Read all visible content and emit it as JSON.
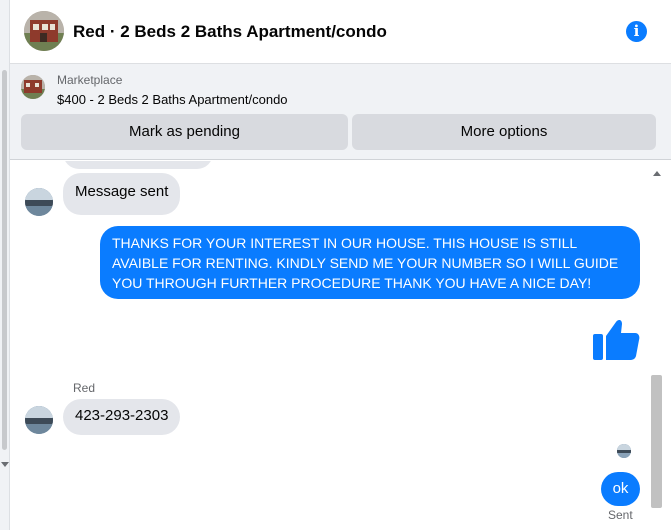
{
  "header": {
    "title": "Red · 2 Beds 2 Baths Apartment/condo",
    "info_icon": "info-icon"
  },
  "marketplace": {
    "label": "Marketplace",
    "listing": "$400 - 2 Beds 2 Baths Apartment/condo",
    "buttons": {
      "pending": "Mark as pending",
      "more": "More options"
    }
  },
  "messages": [
    {
      "from": "other",
      "text": "Message sent"
    },
    {
      "from": "me",
      "text": "THANKS FOR YOUR INTEREST IN OUR HOUSE. THIS HOUSE IS STILL AVAIBLE FOR RENTING. KINDLY SEND ME YOUR NUMBER SO I WILL GUIDE YOU THROUGH FURTHER PROCEDURE THANK YOU HAVE A NICE DAY!"
    },
    {
      "from": "me",
      "type": "like",
      "icon": "thumbs-up-icon"
    },
    {
      "from": "other",
      "sender": "Red",
      "text": "423-293-2303"
    },
    {
      "from": "me",
      "text": "ok",
      "status": "Sent"
    }
  ],
  "colors": {
    "accent": "#0a7cff",
    "incoming_bubble": "#e4e6eb",
    "banner_bg": "#f0f2f5"
  }
}
